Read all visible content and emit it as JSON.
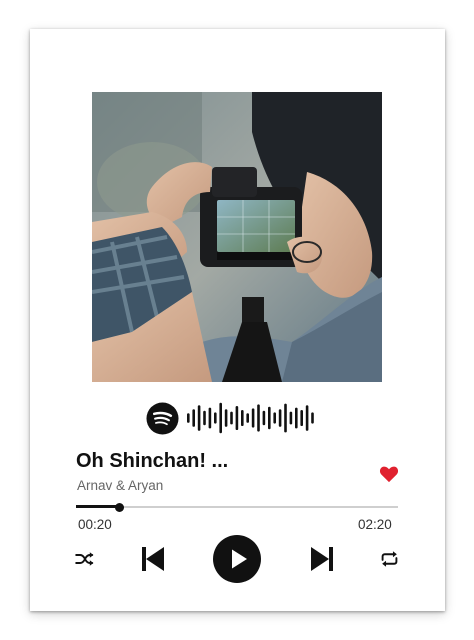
{
  "track": {
    "title": "Oh Shinchan! ...",
    "artist": "Arnav & Aryan",
    "liked": true
  },
  "playback": {
    "elapsed": "00:20",
    "total": "02:20",
    "progress_fraction": 0.135
  },
  "spotify_code": {
    "bar_levels": [
      0.3,
      0.55,
      0.8,
      0.45,
      0.65,
      0.35,
      0.95,
      0.55,
      0.4,
      0.75,
      0.5,
      0.3,
      0.6,
      0.85,
      0.45,
      0.7,
      0.35,
      0.55,
      0.9,
      0.4,
      0.65,
      0.5,
      0.8,
      0.35
    ]
  },
  "icons": {
    "brand": "spotify-logo-icon",
    "artwork": "photographer-with-camera-image",
    "like": "heart-icon",
    "shuffle": "shuffle-icon",
    "previous": "skip-previous-icon",
    "play": "play-icon",
    "next": "skip-next-icon",
    "repeat": "repeat-icon"
  },
  "colors": {
    "accent_heart": "#e0212f",
    "controls": "#111111",
    "progress_track": "#cfcfcf",
    "artist_text": "#666666"
  }
}
